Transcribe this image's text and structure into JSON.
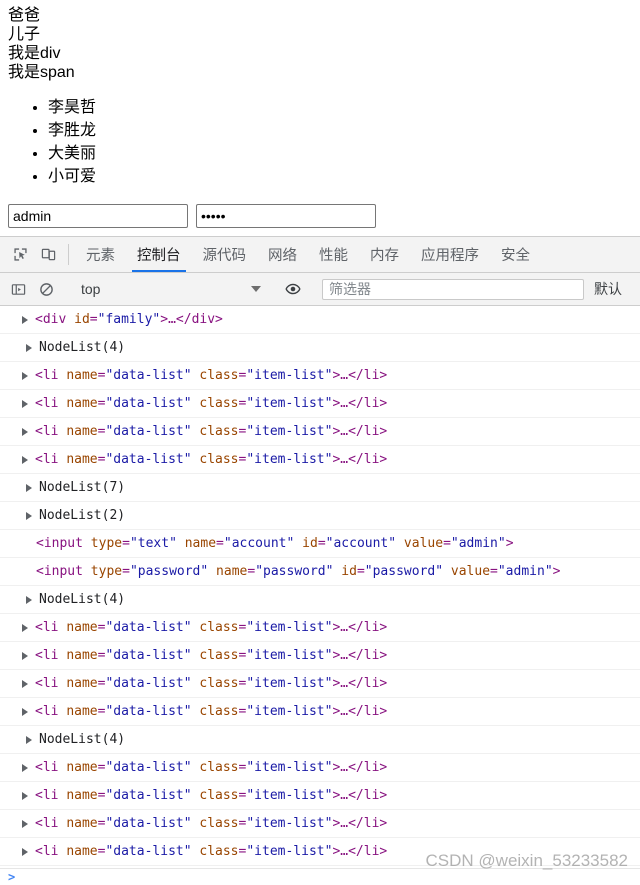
{
  "page": {
    "lines": [
      "爸爸",
      "儿子",
      "我是div",
      "我是span"
    ],
    "list_items": [
      "李昊哲",
      "李胜龙",
      "大美丽",
      "小可爱"
    ],
    "account_input": {
      "value": "admin",
      "placeholder": ""
    },
    "password_input": {
      "value": "admin",
      "masked": "•••••",
      "placeholder": ""
    }
  },
  "devtools": {
    "icons": {
      "inspect": "inspect-element-icon",
      "device": "device-toolbar-icon",
      "sidebar": "console-sidebar-icon",
      "clear": "clear-console-icon",
      "eye": "live-expression-eye-icon"
    },
    "tabs": [
      {
        "label": "元素",
        "active": false
      },
      {
        "label": "控制台",
        "active": true
      },
      {
        "label": "源代码",
        "active": false
      },
      {
        "label": "网络",
        "active": false
      },
      {
        "label": "性能",
        "active": false
      },
      {
        "label": "内存",
        "active": false
      },
      {
        "label": "应用程序",
        "active": false
      },
      {
        "label": "安全",
        "active": false
      }
    ],
    "toolbar": {
      "context": "top",
      "filter_placeholder": "筛选器",
      "filter_value": "",
      "level_label": "默认"
    },
    "messages": [
      {
        "kind": "node",
        "expandable": true,
        "indent": "obj",
        "parts": [
          {
            "t": "punct",
            "s": "<"
          },
          {
            "t": "tag",
            "s": "div"
          },
          {
            "t": "plain_sp",
            "s": " "
          },
          {
            "t": "attr",
            "s": "id"
          },
          {
            "t": "punct",
            "s": "="
          },
          {
            "t": "val",
            "s": "\"family\""
          },
          {
            "t": "punct",
            "s": ">"
          },
          {
            "t": "ell",
            "s": "…"
          },
          {
            "t": "punct",
            "s": "</"
          },
          {
            "t": "tag",
            "s": "div"
          },
          {
            "t": "punct",
            "s": ">"
          }
        ]
      },
      {
        "kind": "text",
        "expandable": true,
        "indent": "nodelist",
        "text": "NodeList(4)"
      },
      {
        "kind": "li",
        "expandable": true,
        "indent": "obj"
      },
      {
        "kind": "li",
        "expandable": true,
        "indent": "obj"
      },
      {
        "kind": "li",
        "expandable": true,
        "indent": "obj"
      },
      {
        "kind": "li",
        "expandable": true,
        "indent": "obj"
      },
      {
        "kind": "text",
        "expandable": true,
        "indent": "nodelist",
        "text": "NodeList(7)"
      },
      {
        "kind": "text",
        "expandable": true,
        "indent": "nodelist",
        "text": "NodeList(2)"
      },
      {
        "kind": "input",
        "expandable": false,
        "indent": "plain",
        "parts": [
          {
            "t": "punct",
            "s": "<"
          },
          {
            "t": "tag",
            "s": "input"
          },
          {
            "t": "plain_sp",
            "s": " "
          },
          {
            "t": "attr",
            "s": "type"
          },
          {
            "t": "punct",
            "s": "="
          },
          {
            "t": "val",
            "s": "\"text\""
          },
          {
            "t": "plain_sp",
            "s": " "
          },
          {
            "t": "attr",
            "s": "name"
          },
          {
            "t": "punct",
            "s": "="
          },
          {
            "t": "val",
            "s": "\"account\""
          },
          {
            "t": "plain_sp",
            "s": " "
          },
          {
            "t": "attr",
            "s": "id"
          },
          {
            "t": "punct",
            "s": "="
          },
          {
            "t": "val",
            "s": "\"account\""
          },
          {
            "t": "plain_sp",
            "s": " "
          },
          {
            "t": "attr",
            "s": "value"
          },
          {
            "t": "punct",
            "s": "="
          },
          {
            "t": "val",
            "s": "\"admin\""
          },
          {
            "t": "punct",
            "s": ">"
          }
        ]
      },
      {
        "kind": "input",
        "expandable": false,
        "indent": "plain",
        "parts": [
          {
            "t": "punct",
            "s": "<"
          },
          {
            "t": "tag",
            "s": "input"
          },
          {
            "t": "plain_sp",
            "s": " "
          },
          {
            "t": "attr",
            "s": "type"
          },
          {
            "t": "punct",
            "s": "="
          },
          {
            "t": "val",
            "s": "\"password\""
          },
          {
            "t": "plain_sp",
            "s": " "
          },
          {
            "t": "attr",
            "s": "name"
          },
          {
            "t": "punct",
            "s": "="
          },
          {
            "t": "val",
            "s": "\"password\""
          },
          {
            "t": "plain_sp",
            "s": " "
          },
          {
            "t": "attr",
            "s": "id"
          },
          {
            "t": "punct",
            "s": "="
          },
          {
            "t": "val",
            "s": "\"password\""
          },
          {
            "t": "plain_sp",
            "s": " "
          },
          {
            "t": "attr",
            "s": "value"
          },
          {
            "t": "punct",
            "s": "="
          },
          {
            "t": "val",
            "s": "\"admin\""
          },
          {
            "t": "punct",
            "s": ">"
          }
        ]
      },
      {
        "kind": "text",
        "expandable": true,
        "indent": "nodelist",
        "text": "NodeList(4)"
      },
      {
        "kind": "li",
        "expandable": true,
        "indent": "obj"
      },
      {
        "kind": "li",
        "expandable": true,
        "indent": "obj"
      },
      {
        "kind": "li",
        "expandable": true,
        "indent": "obj"
      },
      {
        "kind": "li",
        "expandable": true,
        "indent": "obj"
      },
      {
        "kind": "text",
        "expandable": true,
        "indent": "nodelist",
        "text": "NodeList(4)"
      },
      {
        "kind": "li",
        "expandable": true,
        "indent": "obj"
      },
      {
        "kind": "li",
        "expandable": true,
        "indent": "obj"
      },
      {
        "kind": "li",
        "expandable": true,
        "indent": "obj"
      },
      {
        "kind": "li",
        "expandable": true,
        "indent": "obj"
      }
    ],
    "li_parts": [
      {
        "t": "punct",
        "s": "<"
      },
      {
        "t": "tag",
        "s": "li"
      },
      {
        "t": "plain_sp",
        "s": " "
      },
      {
        "t": "attr",
        "s": "name"
      },
      {
        "t": "punct",
        "s": "="
      },
      {
        "t": "val",
        "s": "\"data-list\""
      },
      {
        "t": "plain_sp",
        "s": " "
      },
      {
        "t": "attr",
        "s": "class"
      },
      {
        "t": "punct",
        "s": "="
      },
      {
        "t": "val",
        "s": "\"item-list\""
      },
      {
        "t": "punct",
        "s": ">"
      },
      {
        "t": "ell",
        "s": "…"
      },
      {
        "t": "punct",
        "s": "</"
      },
      {
        "t": "tag",
        "s": "li"
      },
      {
        "t": "punct",
        "s": ">"
      }
    ],
    "prompt_caret": ">",
    "colors": {
      "accent": "#1a73e8",
      "tag": "#881280",
      "attribute": "#994500",
      "value": "#1a1aa6",
      "toolbar_bg": "#f3f3f3"
    }
  },
  "watermark": "CSDN @weixin_53233582"
}
